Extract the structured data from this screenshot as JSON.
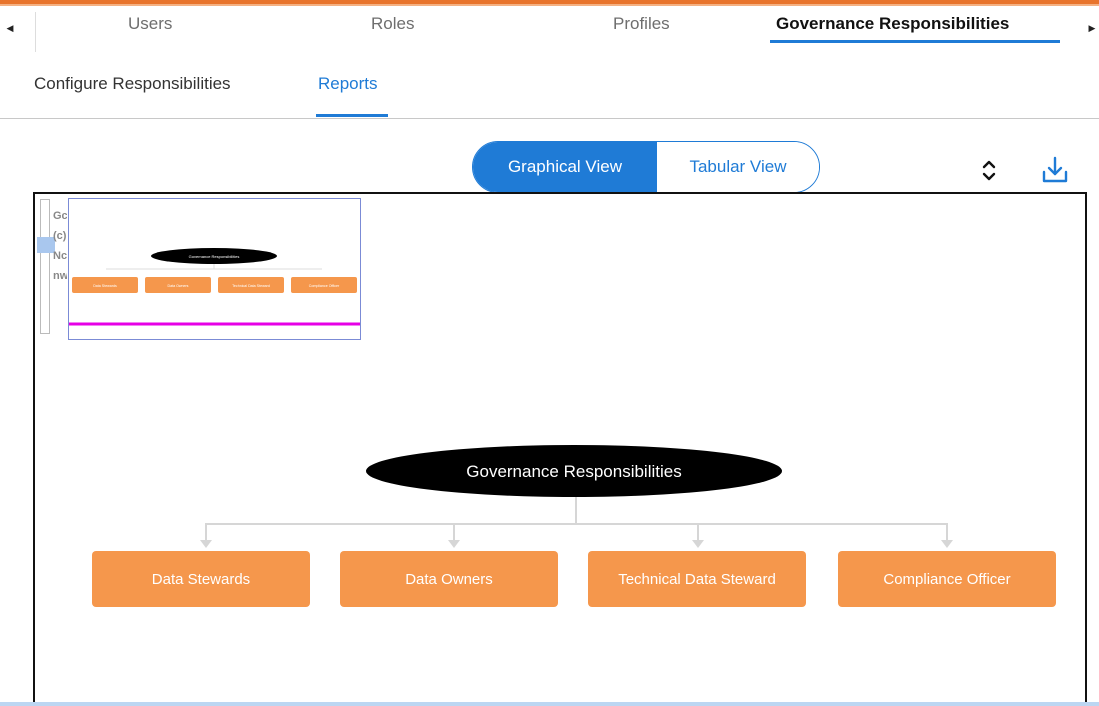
{
  "tabs": {
    "items": [
      {
        "label": "Users",
        "active": false
      },
      {
        "label": "Roles",
        "active": false
      },
      {
        "label": "Profiles",
        "active": false
      },
      {
        "label": "Governance Responsibilities",
        "active": true
      }
    ],
    "scroll_left_icon": "caret-left-icon",
    "scroll_right_icon": "caret-right-icon"
  },
  "subtabs": {
    "items": [
      {
        "label": "Configure Responsibilities",
        "active": false
      },
      {
        "label": "Reports",
        "active": true
      }
    ]
  },
  "view_toggle": {
    "graphical_label": "Graphical View",
    "tabular_label": "Tabular View",
    "selected": "Graphical View"
  },
  "toolbar": {
    "sort_icon": "chevron-up-down-icon",
    "download_icon": "download-icon"
  },
  "minimap": {
    "side_text": [
      "Gc",
      "(c)",
      "Nc",
      "nw"
    ]
  },
  "tree": {
    "root": "Governance Responsibilities",
    "children": [
      "Data Stewards",
      "Data Owners",
      "Technical Data Steward",
      "Compliance Officer"
    ]
  },
  "colors": {
    "accent": "#1f7bd6",
    "brand_top": "#e8742c",
    "node_fill": "#f5974c",
    "root_fill": "#000000",
    "minimap_line": "#e600e6"
  }
}
